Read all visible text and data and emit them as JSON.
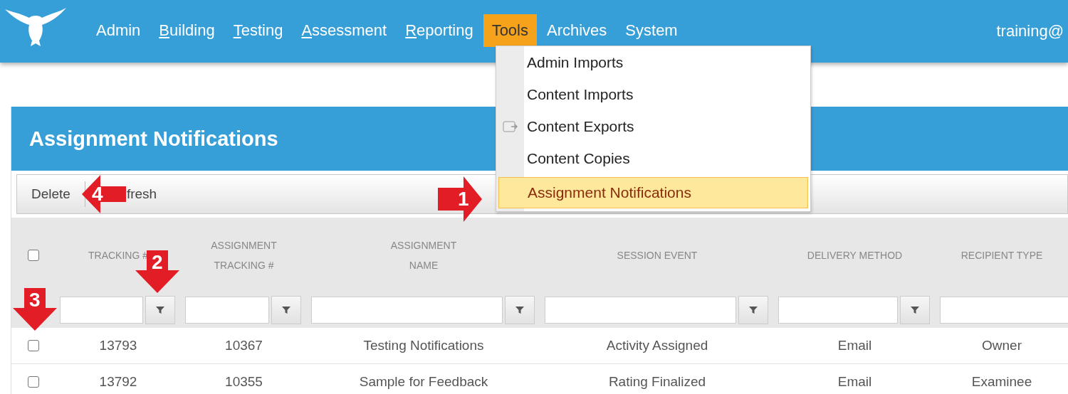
{
  "nav": {
    "items": [
      {
        "label": "Admin",
        "mnemonic": false,
        "selected": false
      },
      {
        "label": "Building",
        "mnemonic": true,
        "selected": false
      },
      {
        "label": "Testing",
        "mnemonic": true,
        "selected": false
      },
      {
        "label": "Assessment",
        "mnemonic": true,
        "selected": false
      },
      {
        "label": "Reporting",
        "mnemonic": true,
        "selected": false
      },
      {
        "label": "Tools",
        "mnemonic": false,
        "selected": true
      },
      {
        "label": "Archives",
        "mnemonic": false,
        "selected": false
      },
      {
        "label": "System",
        "mnemonic": false,
        "selected": false
      }
    ],
    "user": "training@"
  },
  "menu": {
    "items": [
      {
        "label": "Admin Imports",
        "icon": false,
        "selected": false
      },
      {
        "label": "Content Imports",
        "icon": false,
        "selected": false
      },
      {
        "label": "Content Exports",
        "icon": true,
        "selected": false
      },
      {
        "label": "Content Copies",
        "icon": false,
        "selected": false
      },
      {
        "label": "Assignment Notifications",
        "icon": false,
        "selected": true
      }
    ]
  },
  "panel": {
    "title": "Assignment Notifications"
  },
  "toolbar": {
    "buttons": [
      "Delete",
      "fresh"
    ]
  },
  "table": {
    "select_all_checked": false,
    "columns": [
      "TRACKING #",
      "ASSIGNMENT\nTRACKING #",
      "ASSIGNMENT\nNAME",
      "SESSION EVENT",
      "DELIVERY METHOD",
      "RECIPIENT TYPE"
    ],
    "filters": [
      true,
      true,
      true,
      true,
      true,
      false
    ],
    "rows": [
      {
        "checked": false,
        "cells": [
          "13793",
          "10367",
          "Testing Notifications",
          "Activity Assigned",
          "Email",
          "Owner"
        ]
      },
      {
        "checked": false,
        "cells": [
          "13792",
          "10355",
          "Sample for Feedback",
          "Rating Finalized",
          "Email",
          "Examinee"
        ]
      }
    ]
  },
  "annotations": [
    {
      "label": "1",
      "kind": "right"
    },
    {
      "label": "2",
      "kind": "down"
    },
    {
      "label": "3",
      "kind": "down"
    },
    {
      "label": "4",
      "kind": "left"
    }
  ]
}
